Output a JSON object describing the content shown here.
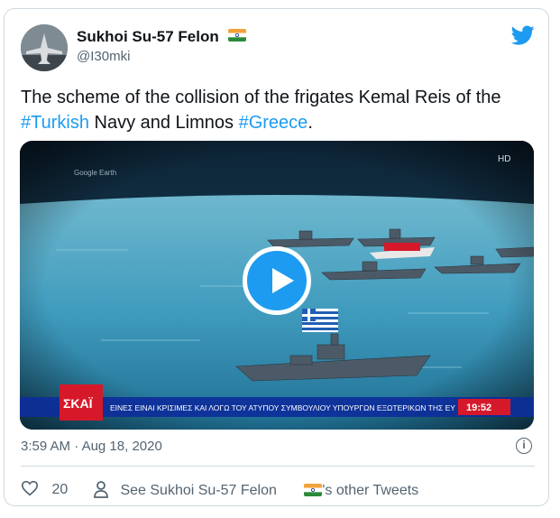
{
  "tweet": {
    "author_name": "Sukhoi Su-57 Felon",
    "author_handle": "@I30mki",
    "text_plain_1": "The scheme of the collision of the frigates Kemal Reis of the ",
    "hashtag_1": "#Turkish",
    "text_plain_2": " Navy and Limnos ",
    "hashtag_2": "#Greece",
    "text_plain_3": ".",
    "timestamp_time": "3:59 AM",
    "timestamp_sep": "·",
    "timestamp_date": "Aug 18, 2020",
    "like_count": "20",
    "see_other_prefix": "See Sukhoi Su-57 Felon",
    "see_other_suffix": "'s other Tweets"
  },
  "video": {
    "hd_label": "HD",
    "watermark": "Google Earth",
    "channel_logo": "ΣΚΑΪ",
    "ticker_text": "ΕΙΝΕΣ ΕΙΝΑΙ ΚΡΙΣΙΜΕΣ ΚΑΙ ΛΟΓΩ ΤΟΥ ΑΤΥΠΟΥ ΣΥΜΒΟΥΛΙΟΥ ΥΠΟΥΡΓΩΝ ΕΞΩΤΕΡΙΚΩΝ ΤΗΣ ΕΥ",
    "ticker_time": "19:52"
  },
  "colors": {
    "accent": "#1d9bf0",
    "text_secondary": "#536471",
    "ticker_bg": "#0d2e9a",
    "logo_red": "#d6192a"
  },
  "icons": [
    "twitter-bird-icon",
    "india-flag-icon",
    "play-icon",
    "info-icon",
    "heart-icon",
    "person-icon",
    "greece-flag-icon"
  ]
}
